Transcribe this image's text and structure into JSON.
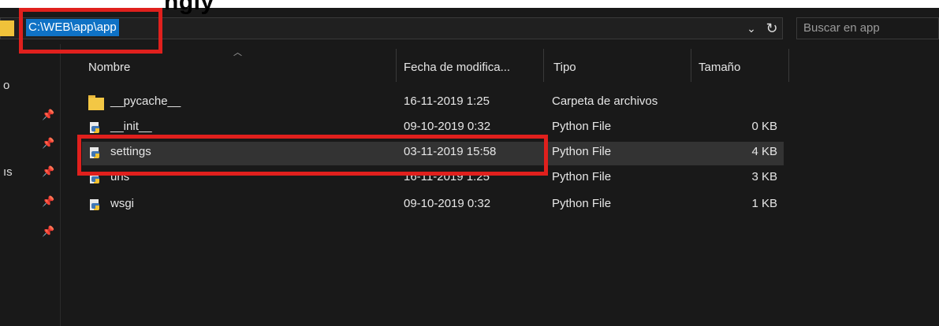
{
  "window": {
    "top_fragment": "ngly"
  },
  "address_bar": {
    "path": "C:\\WEB\\app\\app",
    "dropdown_icon": "chevron-down-icon",
    "refresh_icon": "refresh-icon"
  },
  "search": {
    "placeholder": "Buscar en app"
  },
  "nav": {
    "fragment_1": "o",
    "fragment_2": "ıs",
    "pin_icon": "pin-icon"
  },
  "columns": {
    "name": "Nombre",
    "modified": "Fecha de modifica...",
    "type": "Tipo",
    "size": "Tamaño"
  },
  "files": [
    {
      "name": "__pycache__",
      "modified": "16-11-2019 1:25",
      "type": "Carpeta de archivos",
      "size": "",
      "icon": "folder-icon"
    },
    {
      "name": "__init__",
      "modified": "09-10-2019 0:32",
      "type": "Python File",
      "size": "0 KB",
      "icon": "python-file-icon"
    },
    {
      "name": "settings",
      "modified": "03-11-2019 15:58",
      "type": "Python File",
      "size": "4 KB",
      "icon": "python-file-icon"
    },
    {
      "name": "urls",
      "modified": "16-11-2019 1:25",
      "type": "Python File",
      "size": "3 KB",
      "icon": "python-file-icon"
    },
    {
      "name": "wsgi",
      "modified": "09-10-2019 0:32",
      "type": "Python File",
      "size": "1 KB",
      "icon": "python-file-icon"
    }
  ],
  "colors": {
    "background": "#191919",
    "selection": "#0f72c5",
    "highlight_row": "#333333",
    "annotation": "#e0201d"
  }
}
